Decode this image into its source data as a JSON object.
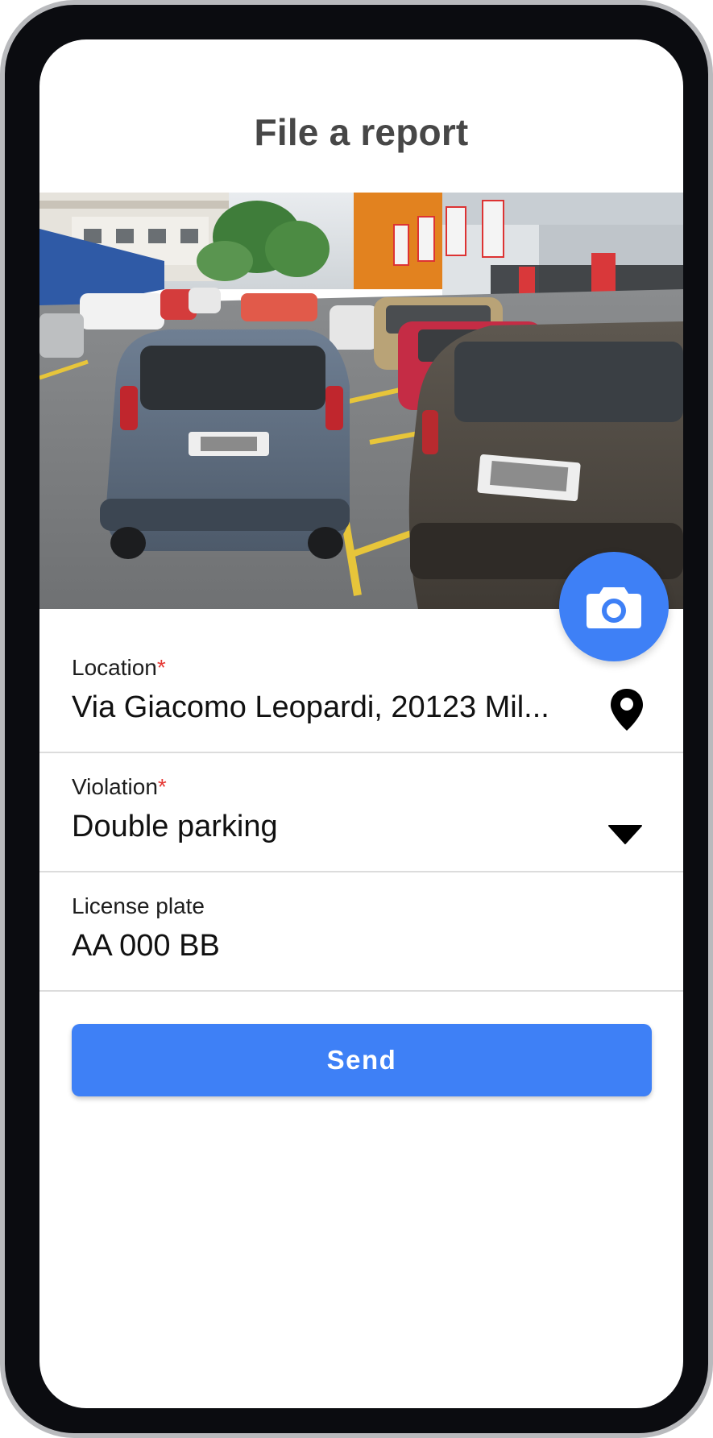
{
  "header": {
    "title": "File a report"
  },
  "photo": {
    "description_icon": "parking-photo",
    "camera_button_icon": "camera-icon"
  },
  "form": {
    "location": {
      "label": "Location",
      "required_mark": "*",
      "value": "Via Giacomo Leopardi, 20123 Mil...",
      "icon": "location-pin-icon"
    },
    "violation": {
      "label": "Violation",
      "required_mark": "*",
      "value": "Double parking",
      "icon": "caret-down-icon"
    },
    "license_plate": {
      "label": "License plate",
      "value": "AA 000 BB"
    }
  },
  "actions": {
    "send_label": "Send"
  },
  "colors": {
    "accent": "#3e80f6",
    "required": "#e53935",
    "title": "#474747"
  }
}
